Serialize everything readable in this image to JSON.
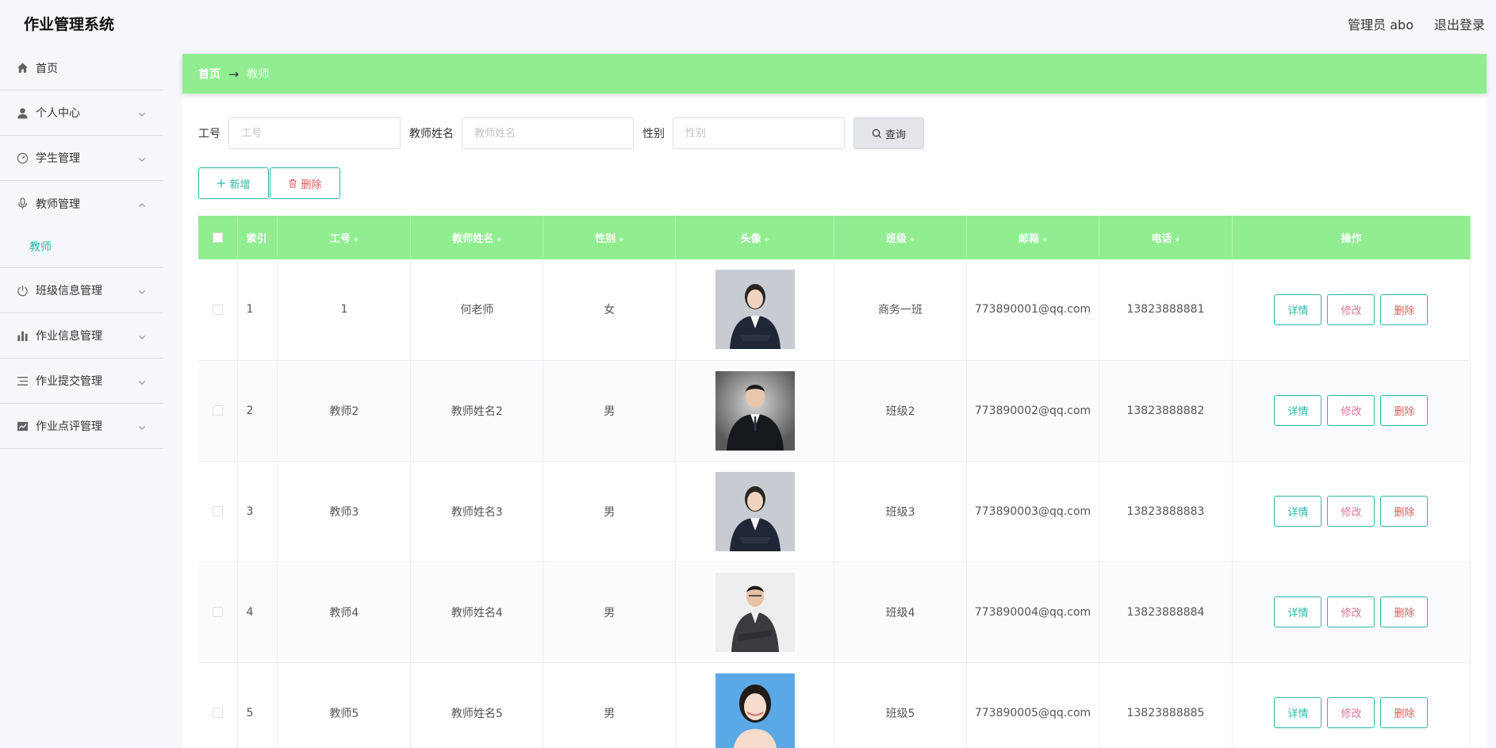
{
  "app": {
    "title": "作业管理系统",
    "admin_label": "管理员 abo",
    "logout_label": "退出登录"
  },
  "sidebar": {
    "items": [
      {
        "label": "首页",
        "icon": "home-icon"
      },
      {
        "label": "个人中心",
        "icon": "user-icon"
      },
      {
        "label": "学生管理",
        "icon": "gauge-icon"
      },
      {
        "label": "教师管理",
        "icon": "microphone-icon",
        "sub": "教师"
      },
      {
        "label": "班级信息管理",
        "icon": "power-icon"
      },
      {
        "label": "作业信息管理",
        "icon": "bar-chart-icon"
      },
      {
        "label": "作业提交管理",
        "icon": "list-icon"
      },
      {
        "label": "作业点评管理",
        "icon": "trend-chart-icon"
      }
    ]
  },
  "breadcrumb": {
    "home": "首页",
    "arrow": "→",
    "current": "教师"
  },
  "search": {
    "id_label": "工号",
    "id_placeholder": "工号",
    "name_label": "教师姓名",
    "name_placeholder": "教师姓名",
    "gender_label": "性别",
    "gender_placeholder": "性别",
    "button": "查询"
  },
  "actions": {
    "add": "新增",
    "delete": "删除"
  },
  "table": {
    "headers": {
      "index": "索引",
      "id": "工号",
      "name": "教师姓名",
      "gender": "性别",
      "avatar": "头像",
      "class": "班级",
      "email": "邮箱",
      "phone": "电话",
      "ops": "操作"
    },
    "rows": [
      {
        "index": "1",
        "id": "1",
        "name": "何老师",
        "gender": "女",
        "class": "商务一班",
        "email": "773890001@qq.com",
        "phone": "13823888881"
      },
      {
        "index": "2",
        "id": "教师2",
        "name": "教师姓名2",
        "gender": "男",
        "class": "班级2",
        "email": "773890002@qq.com",
        "phone": "13823888882"
      },
      {
        "index": "3",
        "id": "教师3",
        "name": "教师姓名3",
        "gender": "男",
        "class": "班级3",
        "email": "773890003@qq.com",
        "phone": "13823888883"
      },
      {
        "index": "4",
        "id": "教师4",
        "name": "教师姓名4",
        "gender": "男",
        "class": "班级4",
        "email": "773890004@qq.com",
        "phone": "13823888884"
      },
      {
        "index": "5",
        "id": "教师5",
        "name": "教师姓名5",
        "gender": "男",
        "class": "班级5",
        "email": "773890005@qq.com",
        "phone": "13823888885"
      }
    ],
    "row_ops": {
      "detail": "详情",
      "edit": "修改",
      "remove": "删除"
    }
  },
  "colors": {
    "accent": "#2bb7a4",
    "header_green": "#90ee90",
    "edit_pink": "#e76f9a",
    "delete_red": "#e05a5a"
  }
}
